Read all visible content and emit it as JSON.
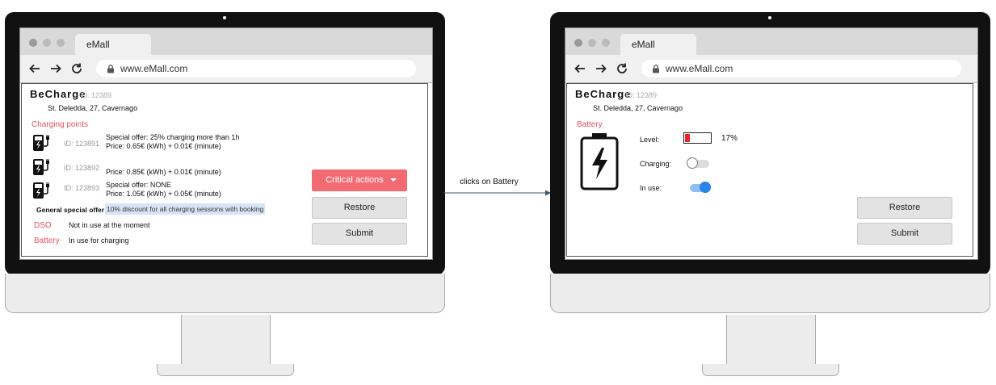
{
  "browser": {
    "tab_label": "eMall",
    "url": "www.eMall.com"
  },
  "shop": {
    "name": "BeCharge",
    "id_label": "ID: 12389",
    "address": "St. Deledda, 27, Cavernago"
  },
  "left_screen": {
    "charging_points_heading": "Charging points",
    "charging_points": [
      {
        "id_label": "ID: 123891",
        "special_offer": "Special offer: 25% charging more than 1h",
        "price": "Price: 0.65€ (kWh) + 0.01€ (minute)"
      },
      {
        "id_label": "ID: 123892",
        "special_offer": "",
        "price": "Price: 0.85€ (kWh) + 0.01€ (minute)"
      },
      {
        "id_label": "ID: 123893",
        "special_offer": "Special offer: NONE",
        "price": "Price: 1.05€ (kWh) + 0.05€ (minute)"
      }
    ],
    "general_offer_label": "General special offer:",
    "general_offer_value": "10% discount for all charging sessions with booking",
    "dso_label": "DSO",
    "dso_value": "Not in use at the moment",
    "battery_label": "Battery",
    "battery_value": "In use for charging",
    "critical_actions_label": "Critical actions",
    "restore_label": "Restore",
    "submit_label": "Submit"
  },
  "transition_label": "clicks on Battery",
  "right_screen": {
    "battery_heading": "Battery",
    "level_label": "Level:",
    "level_value": "17%",
    "level_fraction": 0.17,
    "charging_label": "Charging:",
    "charging_on": false,
    "in_use_label": "In use:",
    "in_use_on": true,
    "restore_label": "Restore",
    "submit_label": "Submit"
  },
  "icons": {
    "charging_point": "ev-charger-icon",
    "battery": "battery-bolt-icon",
    "back": "arrow-left-icon",
    "forward": "arrow-right-icon",
    "reload": "reload-icon",
    "lock": "lock-icon"
  },
  "colors": {
    "accent": "#e8525f",
    "critical_button": "#f36b72",
    "toggle_on": "#2a84e8",
    "battery_level": "#e8252f"
  }
}
